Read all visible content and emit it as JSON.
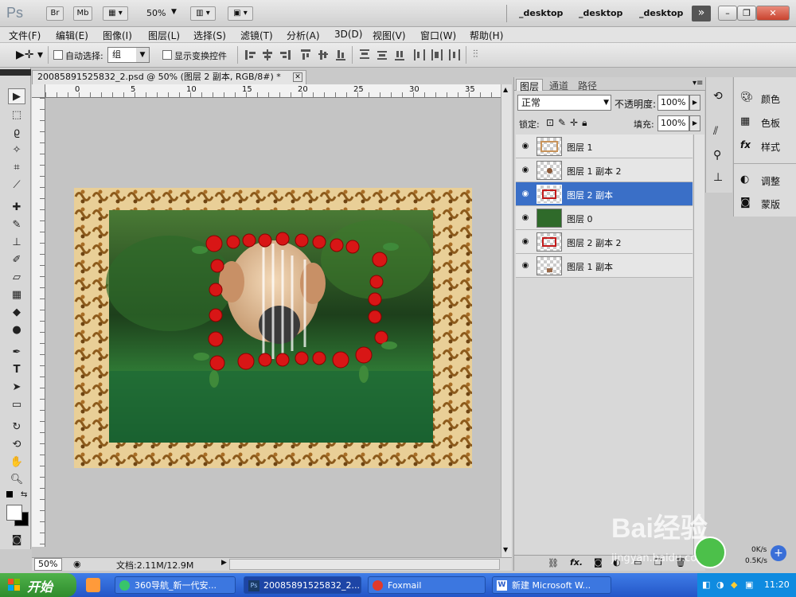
{
  "app": {
    "logo": "Ps",
    "bridge_label": "Br",
    "minibridge_label": "Mb",
    "zoom": "50%",
    "workspaces": [
      "_desktop",
      "_desktop",
      "_desktop"
    ],
    "more_label": "»"
  },
  "menu": [
    "文件(F)",
    "编辑(E)",
    "图像(I)",
    "图层(L)",
    "选择(S)",
    "滤镜(T)",
    "分析(A)",
    "3D(D)",
    "视图(V)",
    "窗口(W)",
    "帮助(H)"
  ],
  "options": {
    "auto_select_label": "自动选择:",
    "auto_select_value": "组",
    "show_transform_label": "显示变换控件"
  },
  "document": {
    "tab_title": "20085891525832_2.psd @ 50% (图层 2 副本, RGB/8#) *",
    "ruler_numbers": [
      "0",
      "5",
      "10",
      "15",
      "20",
      "25",
      "30",
      "35"
    ],
    "zoom_status": "50%",
    "doc_size": "文档:2.11M/12.9M"
  },
  "layers_panel": {
    "tabs": [
      "图层",
      "通道",
      "路径"
    ],
    "blend_mode": "正常",
    "opacity_label": "不透明度:",
    "opacity_value": "100%",
    "lock_label": "锁定:",
    "fill_label": "填充:",
    "fill_value": "100%",
    "layers": [
      {
        "name": "图层 1",
        "selected": false
      },
      {
        "name": "图层 1 副本 2",
        "selected": false
      },
      {
        "name": "图层 2 副本",
        "selected": true
      },
      {
        "name": "图层 0",
        "selected": false
      },
      {
        "name": "图层 2 副本 2",
        "selected": false
      },
      {
        "name": "图层 1 副本",
        "selected": false
      }
    ]
  },
  "right_dock": {
    "items": [
      "颜色",
      "色板",
      "样式",
      "调整",
      "蒙版"
    ]
  },
  "taskbar": {
    "start_label": "开始",
    "tasks": [
      "360导航_新一代安...",
      "20085891525832_2...",
      "Foxmail",
      "新建 Microsoft W..."
    ],
    "net_up": "0K/s",
    "net_down": "0.5K/s",
    "clock": "11:20"
  },
  "watermark": {
    "brand": "Bai经验",
    "url": "jingyan.baidu.com"
  },
  "colors": {
    "selection_blue": "#3a6fc7",
    "taskbar_blue": "#2456c7",
    "start_green": "#3a9e36"
  }
}
